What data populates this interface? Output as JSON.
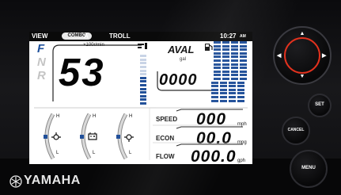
{
  "status_bar": {
    "mode": "VIEW",
    "combo": "COMBO",
    "combo_suffix": "A",
    "troll": "TROLL",
    "time": "10:27",
    "ampm": "AM"
  },
  "gears": [
    "F",
    "N",
    "R"
  ],
  "tach": {
    "unit": "×100r/min",
    "value": "53",
    "bar_fill_fraction": 0.55
  },
  "fuel": {
    "label": "AVAL",
    "unit": "gal",
    "value": "0000",
    "level_fraction": 1.0
  },
  "engines": [
    {
      "high": "H",
      "low": "L",
      "icon": "engine-temperature-icon",
      "level": "mid"
    },
    {
      "high": "H",
      "low": "L",
      "icon": "battery-icon",
      "level": "mid"
    },
    {
      "high": "H",
      "low": "L",
      "icon": "oil-pressure-icon",
      "level": "mid"
    }
  ],
  "readouts": {
    "speed": {
      "label": "SPEED",
      "value": "000",
      "unit": "mph"
    },
    "econ": {
      "label": "ECON",
      "value": "00.0",
      "unit": "mpg"
    },
    "flow": {
      "label": "FLOW",
      "value": "000.0",
      "unit": "gph"
    }
  },
  "brand": "YAMAHA",
  "buttons": {
    "set": "SET",
    "cancel": "CANCEL",
    "menu": "MENU"
  },
  "colors": {
    "accent_red": "#e2321e",
    "bar_blue": "#204f99",
    "screen_bg": "#ffffff"
  }
}
